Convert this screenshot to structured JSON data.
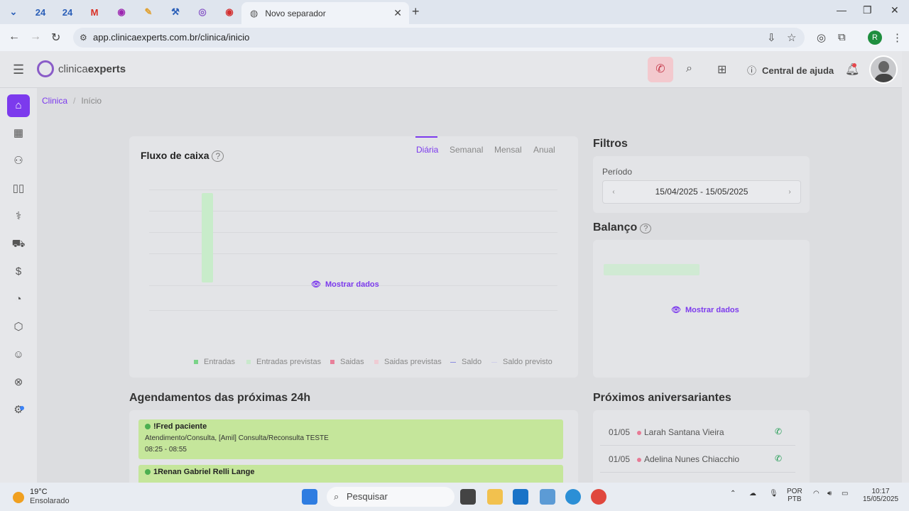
{
  "browser": {
    "tab_pins": [
      "24",
      "24"
    ],
    "active_tab_title": "Novo separador",
    "url": "app.clinicaexperts.com.br/clinica/inicio",
    "profile_initial": "R"
  },
  "header": {
    "logo_prefix": "clinica",
    "logo_suffix": "experts",
    "help_label": "Central de ajuda"
  },
  "breadcrumb": {
    "root": "Clinica",
    "current": "Início"
  },
  "cash_flow": {
    "title": "Fluxo de caixa",
    "tabs": [
      "Diária",
      "Semanal",
      "Mensal",
      "Anual"
    ],
    "active_tab": "Diária",
    "show_data": "Mostrar dados",
    "legend": [
      "Entradas",
      "Entradas previstas",
      "Saidas",
      "Saidas previstas",
      "Saldo",
      "Saldo previsto"
    ]
  },
  "filters": {
    "title": "Filtros",
    "period_label": "Período",
    "period_value": "15/04/2025 - 15/05/2025"
  },
  "balance": {
    "title": "Balanço",
    "show_data": "Mostrar dados"
  },
  "appointments": {
    "title": "Agendamentos das próximas 24h",
    "items": [
      {
        "name": "!Fred paciente",
        "detail": "Atendimento/Consulta, [Amil] Consulta/Reconsulta TESTE",
        "time": "08:25 - 08:55"
      },
      {
        "name": "1Renan Gabriel Relli Lange",
        "detail": "",
        "time": ""
      }
    ]
  },
  "birthdays": {
    "title": "Próximos aniversariantes",
    "items": [
      {
        "date": "01/05",
        "name": "Larah Santana Vieira"
      },
      {
        "date": "01/05",
        "name": "Adelina Nunes Chiacchio"
      }
    ]
  },
  "taskbar": {
    "temp": "19°C",
    "weather": "Ensolarado",
    "search_placeholder": "Pesquisar",
    "lang1": "POR",
    "lang2": "PTB",
    "time": "10:17",
    "date": "15/05/2025"
  },
  "colors": {
    "accent": "#7c3aed",
    "appt_bg": "#c5e69b",
    "whatsapp": "#1d9b50"
  }
}
